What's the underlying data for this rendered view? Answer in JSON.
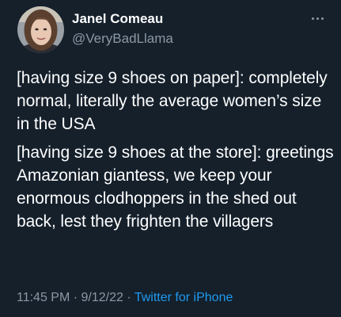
{
  "author": {
    "display_name": "Janel Comeau",
    "handle": "@VeryBadLlama"
  },
  "more_icon": "more-horizontal-icon",
  "tweet": {
    "text_part1": "[having size 9 shoes on paper]: completely normal, literally the average women’s size in the USA",
    "text_part2": "[having size 9 shoes at the store]: greetings Amazonian giantess, we keep your enormous clodhoppers in the shed out back, lest they frighten the villagers"
  },
  "meta": {
    "time": "11:45 PM",
    "separator": "·",
    "date": "9/12/22",
    "source": "Twitter for iPhone"
  },
  "colors": {
    "background": "#15202b",
    "text": "#ffffff",
    "secondary": "#8b98a5",
    "link": "#1d9bf0"
  }
}
